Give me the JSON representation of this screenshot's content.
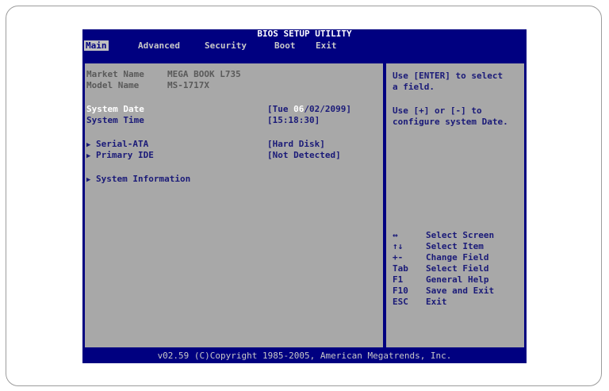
{
  "title": "BIOS SETUP UTILITY",
  "menu": [
    "Main",
    "Advanced",
    "Security",
    "Boot",
    "Exit"
  ],
  "info": {
    "market_label": "Market Name",
    "market_value": "MEGA BOOK L735",
    "model_label": "Model Name",
    "model_value": "MS-1717X"
  },
  "system_date": {
    "label": "System Date",
    "day": "[Tue",
    "month": "06",
    "rest": "/02/2099]"
  },
  "system_time": {
    "label": "System Time",
    "value": "[15:18:30]"
  },
  "submenus": [
    {
      "label": "Serial-ATA",
      "value": "[Hard Disk]"
    },
    {
      "label": "Primary IDE",
      "value": "[Not Detected]"
    },
    {
      "label": "System Information",
      "value": ""
    }
  ],
  "help": {
    "line1": "Use [ENTER] to select",
    "line2": "a field.",
    "line3": "Use [+] or [-] to",
    "line4": "configure system Date."
  },
  "keys": [
    {
      "key": "↔",
      "action": "Select Screen"
    },
    {
      "key": "↑↓",
      "action": "Select Item"
    },
    {
      "key": "+-",
      "action": "Change Field"
    },
    {
      "key": "Tab",
      "action": "Select Field"
    },
    {
      "key": "F1",
      "action": "General Help"
    },
    {
      "key": "F10",
      "action": "Save and Exit"
    },
    {
      "key": "ESC",
      "action": "Exit"
    }
  ],
  "footer": "v02.59 (C)Copyright 1985-2005, American Megatrends, Inc."
}
